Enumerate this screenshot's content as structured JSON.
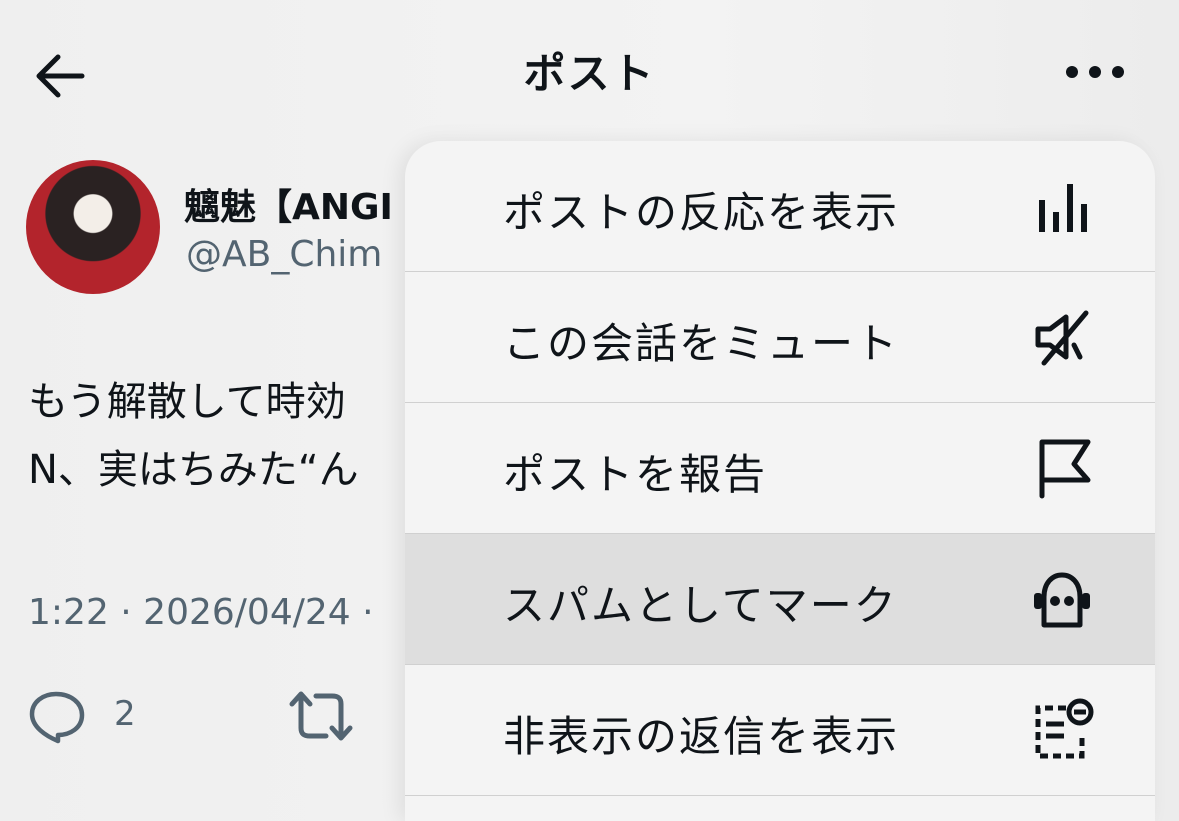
{
  "header": {
    "title": "ポスト",
    "back_icon": "arrow-left-icon",
    "more_icon": "more-horizontal-icon"
  },
  "post": {
    "username": "魑魅【ANGI",
    "handle": "@AB_Chim",
    "text": "もう解散して時効\nN、実はちみた“ん",
    "timestamp": "1:22 · 2026/04/24 ·",
    "reply_count": "2"
  },
  "menu": {
    "items": [
      {
        "label": "ポストの反応を表示",
        "icon": "bar-chart-icon"
      },
      {
        "label": "この会話をミュート",
        "icon": "mute-speaker-icon"
      },
      {
        "label": "ポストを報告",
        "icon": "flag-icon"
      },
      {
        "label": "スパムとしてマーク",
        "icon": "robot-icon",
        "highlighted": true
      },
      {
        "label": "非表示の返信を表示",
        "icon": "hidden-replies-icon"
      }
    ]
  },
  "colors": {
    "text": "#0f1419",
    "secondary": "#536471",
    "menu_bg": "#f4f4f4",
    "highlight": "#dedede"
  }
}
